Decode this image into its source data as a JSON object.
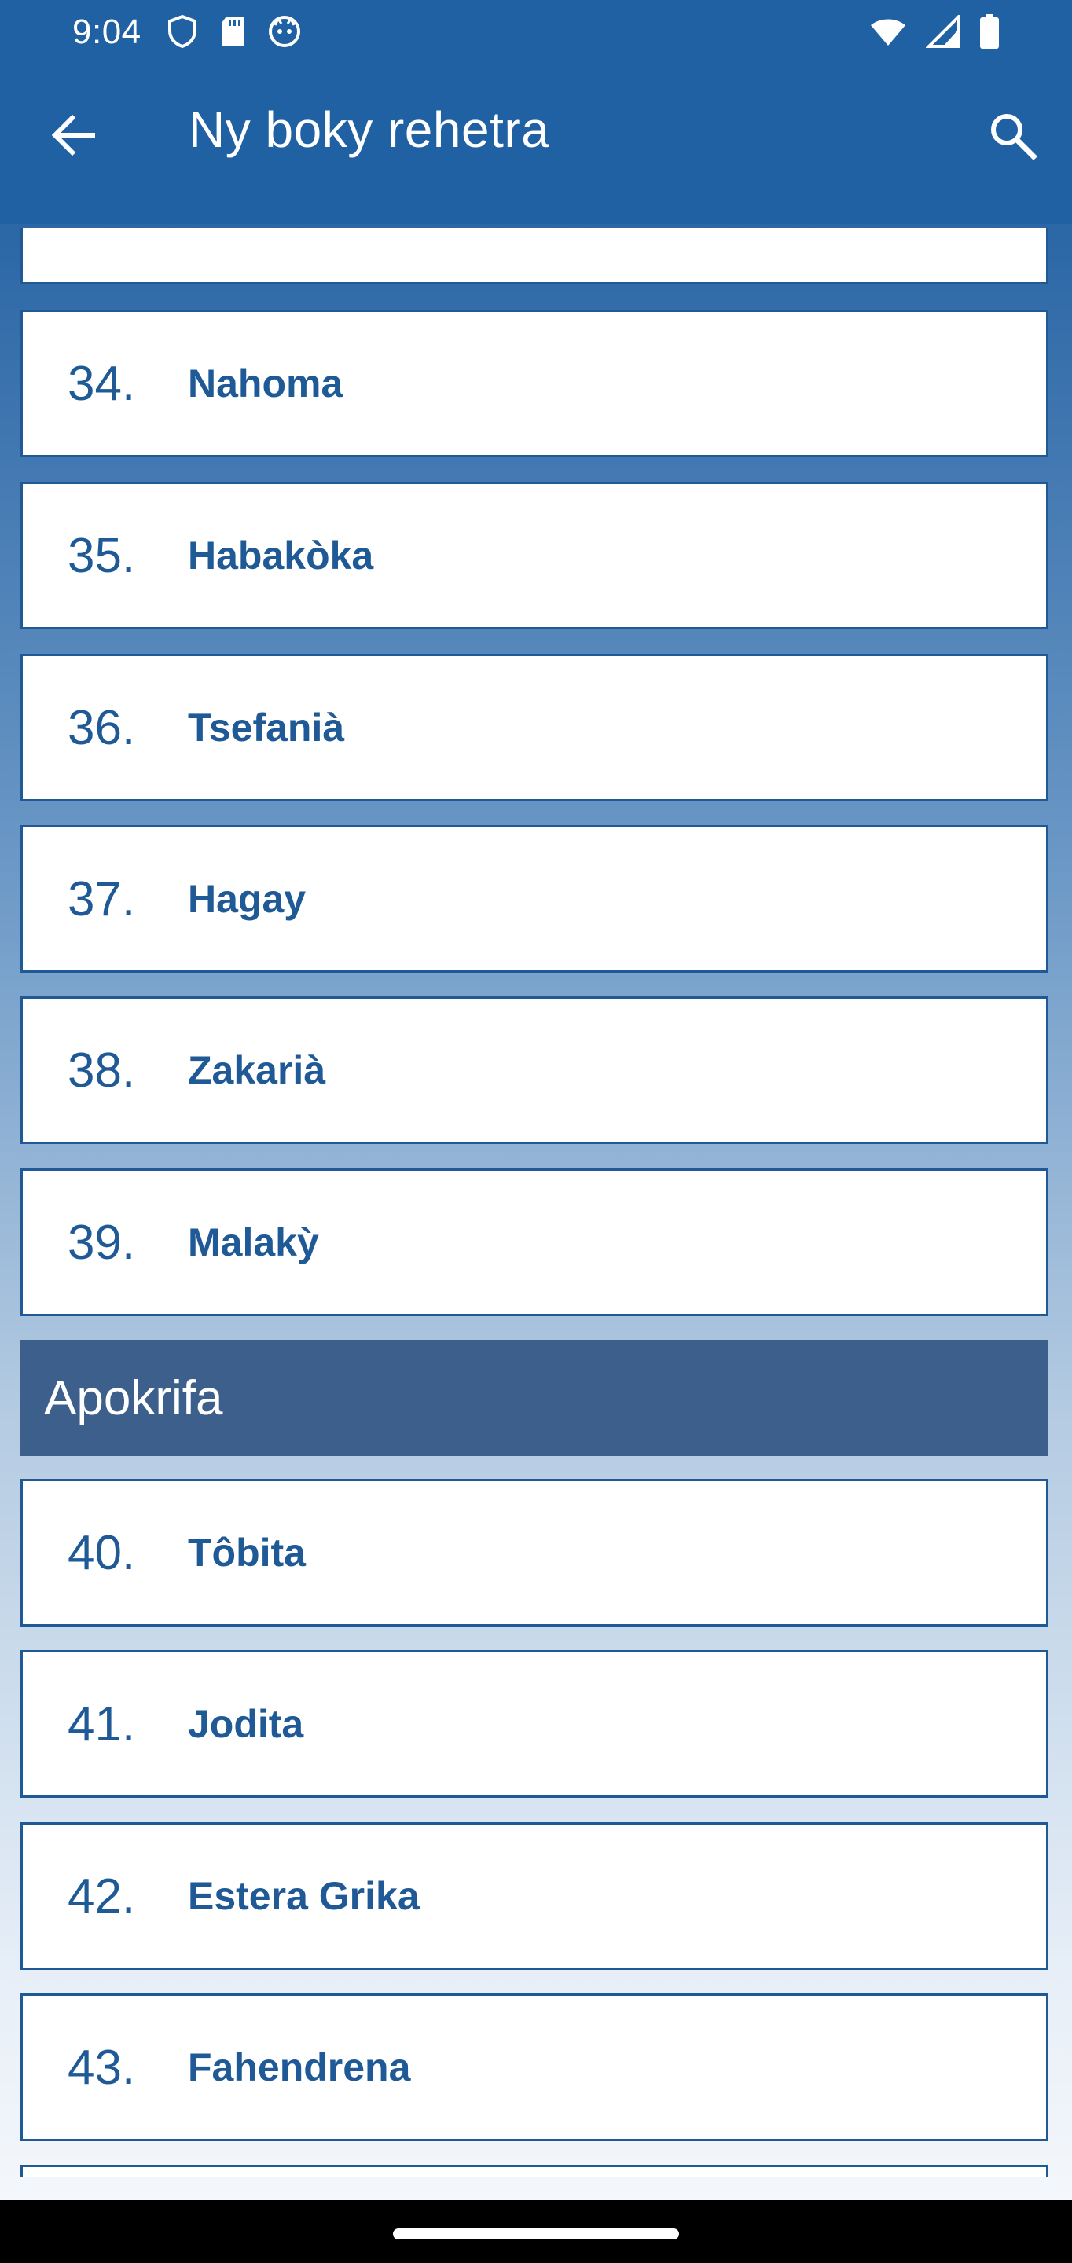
{
  "status_bar": {
    "time": "9:04",
    "left_icons": [
      "shield-icon",
      "sd-card-icon",
      "cat-face-icon"
    ],
    "right_icons": [
      "wifi-icon",
      "signal-icon",
      "battery-icon"
    ]
  },
  "appbar": {
    "title": "Ny boky rehetra",
    "back_icon": "arrow-left-icon",
    "search_icon": "search-icon"
  },
  "books_before": [
    {
      "number": "34.",
      "name": "Nahoma"
    },
    {
      "number": "35.",
      "name": "Habakòka"
    },
    {
      "number": "36.",
      "name": "Tsefanià"
    },
    {
      "number": "37.",
      "name": "Hagay"
    },
    {
      "number": "38.",
      "name": "Zakarià"
    },
    {
      "number": "39.",
      "name": "Malakỳ"
    }
  ],
  "section": {
    "title": "Apokrifa"
  },
  "books_after": [
    {
      "number": "40.",
      "name": "Tôbita"
    },
    {
      "number": "41.",
      "name": "Jodita"
    },
    {
      "number": "42.",
      "name": "Estera Grika"
    },
    {
      "number": "43.",
      "name": "Fahendrena"
    }
  ],
  "colors": {
    "primary": "#1f61a3",
    "section": "#3c5f8b",
    "text": "#1f5a97"
  }
}
